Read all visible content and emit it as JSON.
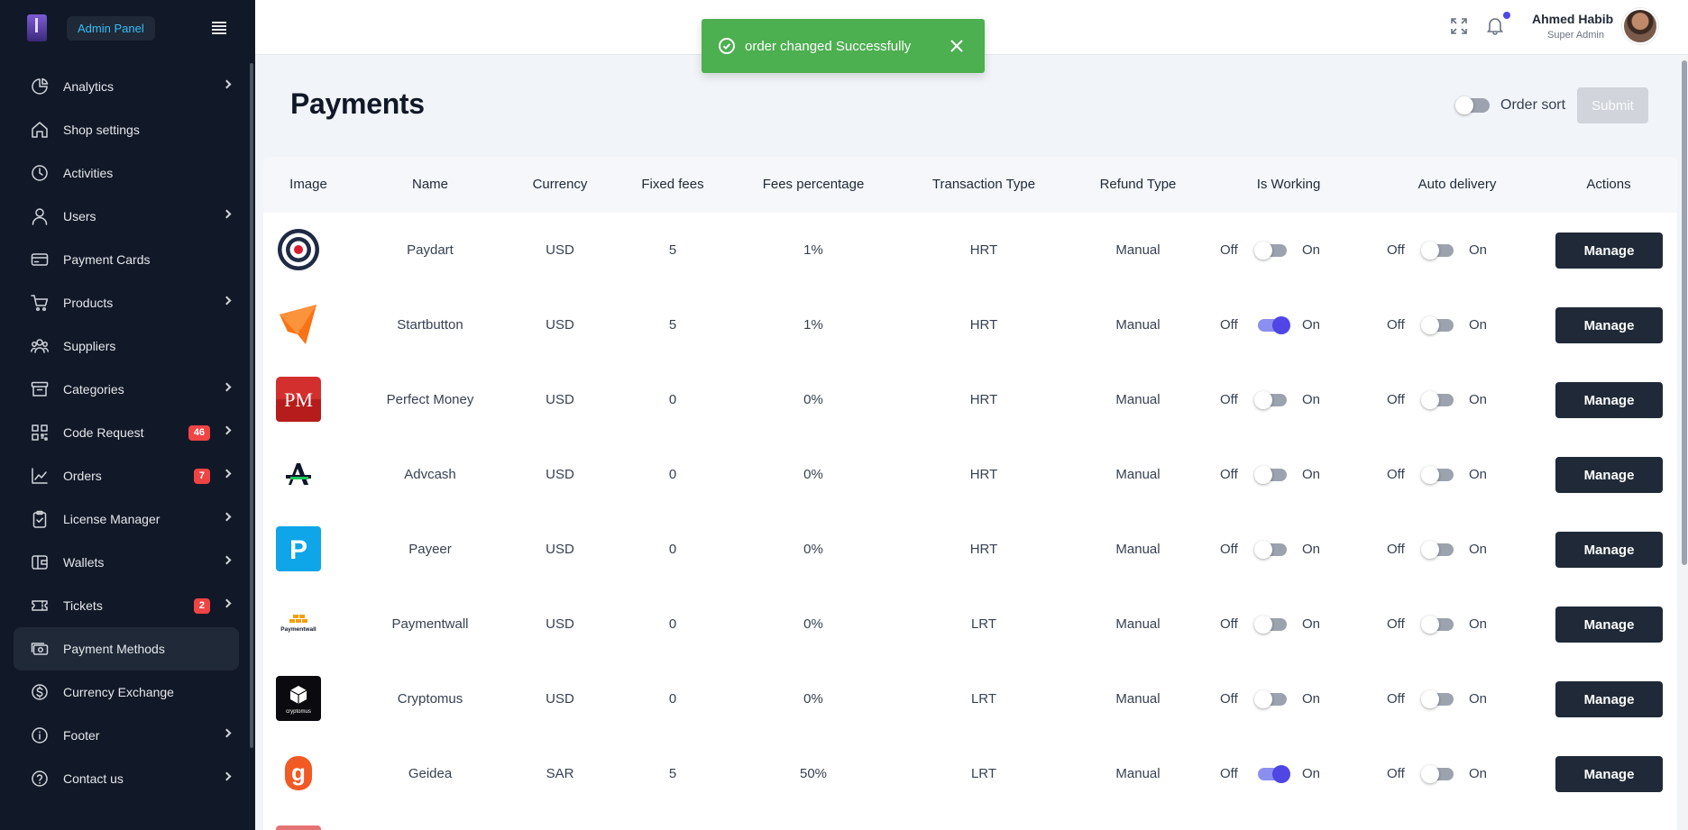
{
  "sidebar": {
    "brand_label": "Admin Panel",
    "items": [
      {
        "label": "Analytics",
        "icon": "pie-chart-icon",
        "chevron": true,
        "badge": ""
      },
      {
        "label": "Shop settings",
        "icon": "home-icon",
        "chevron": false,
        "badge": ""
      },
      {
        "label": "Activities",
        "icon": "clock-icon",
        "chevron": false,
        "badge": ""
      },
      {
        "label": "Users",
        "icon": "user-icon",
        "chevron": true,
        "badge": ""
      },
      {
        "label": "Payment Cards",
        "icon": "credit-card-icon",
        "chevron": false,
        "badge": ""
      },
      {
        "label": "Products",
        "icon": "cart-icon",
        "chevron": true,
        "badge": ""
      },
      {
        "label": "Suppliers",
        "icon": "users-group-icon",
        "chevron": false,
        "badge": ""
      },
      {
        "label": "Categories",
        "icon": "archive-icon",
        "chevron": true,
        "badge": ""
      },
      {
        "label": "Code Request",
        "icon": "qr-code-icon",
        "chevron": true,
        "badge": "46"
      },
      {
        "label": "Orders",
        "icon": "line-chart-icon",
        "chevron": true,
        "badge": "7"
      },
      {
        "label": "License Manager",
        "icon": "clipboard-check-icon",
        "chevron": true,
        "badge": ""
      },
      {
        "label": "Wallets",
        "icon": "wallet-icon",
        "chevron": true,
        "badge": ""
      },
      {
        "label": "Tickets",
        "icon": "ticket-icon",
        "chevron": true,
        "badge": "2"
      },
      {
        "label": "Payment Methods",
        "icon": "cash-icon",
        "chevron": false,
        "badge": "",
        "active": true
      },
      {
        "label": "Currency Exchange",
        "icon": "dollar-circle-icon",
        "chevron": false,
        "badge": ""
      },
      {
        "label": "Footer",
        "icon": "info-icon",
        "chevron": true,
        "badge": ""
      },
      {
        "label": "Contact us",
        "icon": "help-circle-icon",
        "chevron": true,
        "badge": ""
      }
    ]
  },
  "header": {
    "user_name": "Ahmed Habib",
    "user_role": "Super Admin"
  },
  "toast": {
    "message": "order changed Successfully",
    "color": "#4caf50"
  },
  "page": {
    "title": "Payments",
    "order_sort_label": "Order sort",
    "submit_label": "Submit"
  },
  "table": {
    "columns": [
      "Image",
      "Name",
      "Currency",
      "Fixed fees",
      "Fees percentage",
      "Transaction Type",
      "Refund Type",
      "Is Working",
      "Auto delivery",
      "Actions"
    ],
    "off_label": "Off",
    "on_label": "On",
    "manage_label": "Manage",
    "rows": [
      {
        "name": "Paydart",
        "currency": "USD",
        "fixed_fees": "5",
        "fees_percentage": "1%",
        "transaction_type": "HRT",
        "refund_type": "Manual",
        "is_working": false,
        "auto_delivery": false,
        "logo": "paydart-logo"
      },
      {
        "name": "Startbutton",
        "currency": "USD",
        "fixed_fees": "5",
        "fees_percentage": "1%",
        "transaction_type": "HRT",
        "refund_type": "Manual",
        "is_working": true,
        "auto_delivery": false,
        "logo": "startbutton-logo"
      },
      {
        "name": "Perfect Money",
        "currency": "USD",
        "fixed_fees": "0",
        "fees_percentage": "0%",
        "transaction_type": "HRT",
        "refund_type": "Manual",
        "is_working": false,
        "auto_delivery": false,
        "logo": "perfect-money-logo",
        "logo_text": "PM"
      },
      {
        "name": "Advcash",
        "currency": "USD",
        "fixed_fees": "0",
        "fees_percentage": "0%",
        "transaction_type": "HRT",
        "refund_type": "Manual",
        "is_working": false,
        "auto_delivery": false,
        "logo": "advcash-logo"
      },
      {
        "name": "Payeer",
        "currency": "USD",
        "fixed_fees": "0",
        "fees_percentage": "0%",
        "transaction_type": "HRT",
        "refund_type": "Manual",
        "is_working": false,
        "auto_delivery": false,
        "logo": "payeer-logo",
        "logo_text": "P"
      },
      {
        "name": "Paymentwall",
        "currency": "USD",
        "fixed_fees": "0",
        "fees_percentage": "0%",
        "transaction_type": "LRT",
        "refund_type": "Manual",
        "is_working": false,
        "auto_delivery": false,
        "logo": "paymentwall-logo",
        "logo_text": "Paymentwall"
      },
      {
        "name": "Cryptomus",
        "currency": "USD",
        "fixed_fees": "0",
        "fees_percentage": "0%",
        "transaction_type": "LRT",
        "refund_type": "Manual",
        "is_working": false,
        "auto_delivery": false,
        "logo": "cryptomus-logo",
        "logo_text": "cryptomus"
      },
      {
        "name": "Geidea",
        "currency": "SAR",
        "fixed_fees": "5",
        "fees_percentage": "50%",
        "transaction_type": "LRT",
        "refund_type": "Manual",
        "is_working": true,
        "auto_delivery": false,
        "logo": "geidea-logo",
        "logo_text": "g"
      }
    ]
  },
  "colors": {
    "sidebar_bg": "#111827",
    "accent": "#4f46e5",
    "manage_button": "#1f2937",
    "badge": "#ef4444"
  }
}
